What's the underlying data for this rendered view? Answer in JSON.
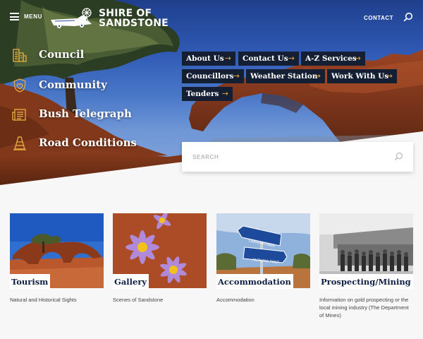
{
  "header": {
    "menu_label": "MENU",
    "logo_line1": "SHIRE OF",
    "logo_line2": "SANDSTONE",
    "contact_label": "CONTACT",
    "search_icon": "search-icon"
  },
  "main_nav": [
    {
      "label": "Council",
      "icon": "city-buildings-icon"
    },
    {
      "label": "Community",
      "icon": "community-badge-icon"
    },
    {
      "label": "Bush Telegraph",
      "icon": "newspaper-icon"
    },
    {
      "label": "Road Conditions",
      "icon": "traffic-cone-icon"
    }
  ],
  "quick_links": [
    {
      "label": "About Us"
    },
    {
      "label": "Contact Us"
    },
    {
      "label": "A-Z Services"
    },
    {
      "label": "Councillors"
    },
    {
      "label": "Weather Station"
    },
    {
      "label": "Work With Us"
    },
    {
      "label": "Tenders"
    }
  ],
  "search": {
    "placeholder": "SEARCH"
  },
  "cards": [
    {
      "title": "Tourism",
      "desc": "Natural and Historical Sights"
    },
    {
      "title": "Gallery",
      "desc": "Scenes of Sandstone"
    },
    {
      "title": "Accommodation",
      "desc": "Accommodation"
    },
    {
      "title": "Prospecting/Mining",
      "desc": "Information on gold prospecting or the local mining industry (The Department of Mines)"
    }
  ],
  "signs": {
    "sign1": "CARAVAN PARK",
    "sign2": "NURSING POST"
  },
  "colors": {
    "nav_bg": "#141f33",
    "arrow": "#e6a740",
    "icon_gold": "#e0a73c",
    "card_title": "#0e1f44"
  }
}
